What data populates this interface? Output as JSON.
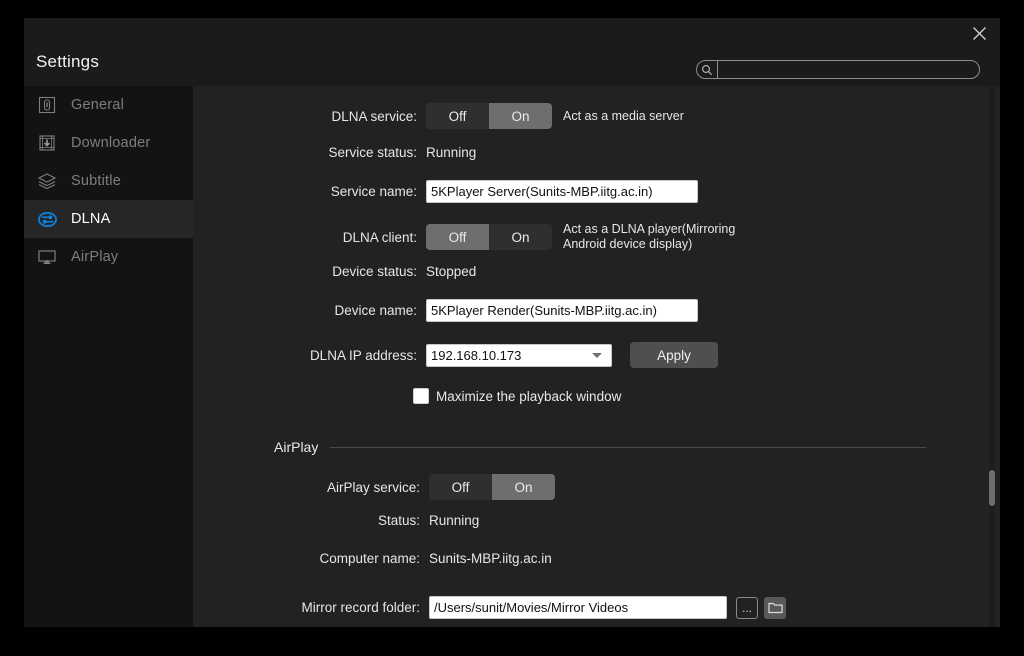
{
  "window": {
    "title": "Settings",
    "close_icon": "close-icon"
  },
  "search": {
    "icon": "search-icon",
    "value": "",
    "placeholder": ""
  },
  "sidebar": {
    "items": [
      {
        "label": "General",
        "icon": "general-icon",
        "active": false
      },
      {
        "label": "Downloader",
        "icon": "downloader-icon",
        "active": false
      },
      {
        "label": "Subtitle",
        "icon": "subtitle-icon",
        "active": false
      },
      {
        "label": "DLNA",
        "icon": "dlna-icon",
        "active": true
      },
      {
        "label": "AirPlay",
        "icon": "airplay-icon",
        "active": false
      }
    ],
    "accent_color": "#0a84e0",
    "active_bg": "#262626"
  },
  "dlna": {
    "service": {
      "label": "DLNA service:",
      "options": [
        "Off",
        "On"
      ],
      "selected": "On",
      "hint": "Act as a media server"
    },
    "service_status": {
      "label": "Service status:",
      "value": "Running"
    },
    "service_name": {
      "label": "Service name:",
      "value": "5KPlayer Server(Sunits-MBP.iitg.ac.in)",
      "placeholder": ""
    },
    "client": {
      "label": "DLNA client:",
      "options": [
        "Off",
        "On"
      ],
      "selected": "Off",
      "hint": "Act as a DLNA player(Mirroring\nAndroid device display)"
    },
    "device_status": {
      "label": "Device status:",
      "value": "Stopped"
    },
    "device_name": {
      "label": "Device name:",
      "value": "5KPlayer Render(Sunits-MBP.iitg.ac.in)",
      "placeholder": ""
    },
    "ip_address": {
      "label": "DLNA IP address:",
      "value": "192.168.10.173",
      "options": [
        "192.168.10.173"
      ],
      "arrow_icon": "chevron-down-icon"
    },
    "apply_button": "Apply",
    "maximize_checkbox": {
      "label": "Maximize the playback window",
      "checked": false
    }
  },
  "airplay": {
    "section_title": "AirPlay",
    "service": {
      "label": "AirPlay service:",
      "options": [
        "Off",
        "On"
      ],
      "selected": "On"
    },
    "status": {
      "label": "Status:",
      "value": "Running"
    },
    "computer_name": {
      "label": "Computer name:",
      "value": "Sunits-MBP.iitg.ac.in"
    },
    "mirror_folder": {
      "label": "Mirror record folder:",
      "value": "/Users/sunit/Movies/Mirror Videos",
      "placeholder": "",
      "browse_button": "...",
      "open_folder_icon": "folder-icon"
    }
  }
}
